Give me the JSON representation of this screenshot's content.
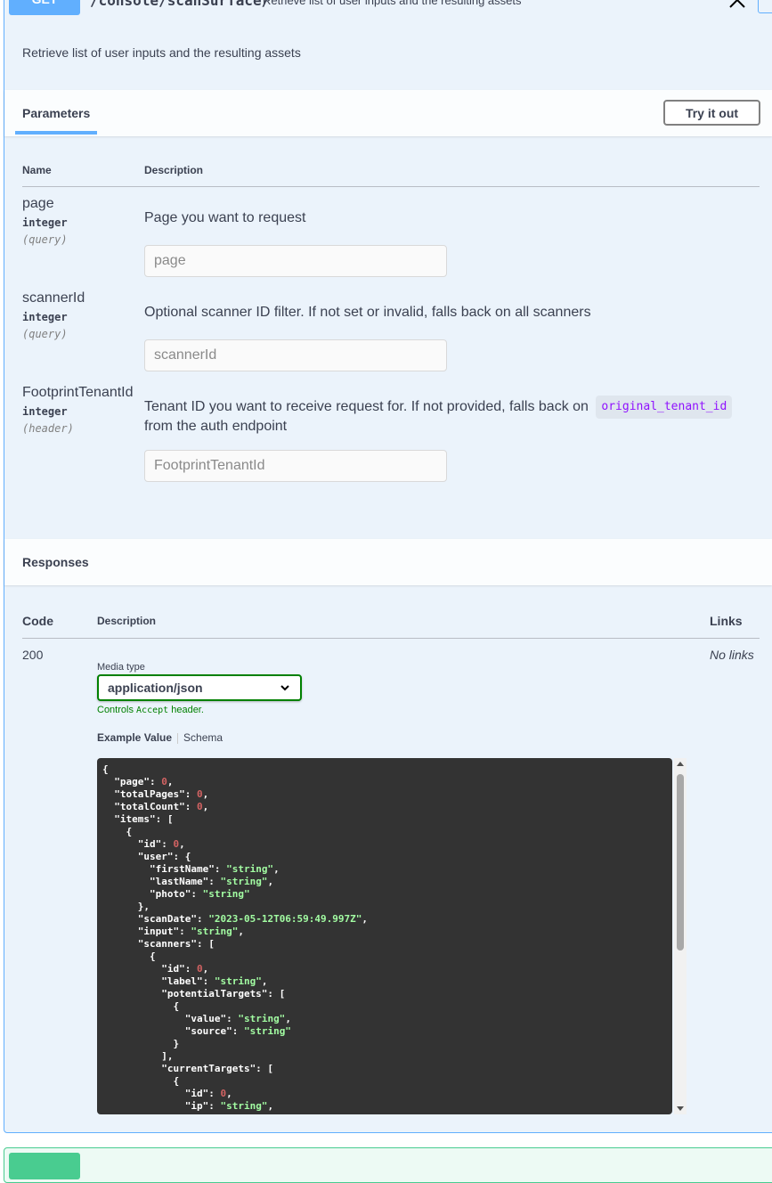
{
  "operation": {
    "method": "GET",
    "path": "/console/scanSurface/",
    "summary": "Retrieve list of user inputs and the resulting assets",
    "description": "Retrieve list of user inputs and the resulting assets"
  },
  "parameters": {
    "tab_label": "Parameters",
    "try_button": "Try it out",
    "col_name": "Name",
    "col_description": "Description",
    "items": [
      {
        "name": "page",
        "type": "integer",
        "in": "(query)",
        "description": "Page you want to request",
        "placeholder": "page"
      },
      {
        "name": "scannerId",
        "type": "integer",
        "in": "(query)",
        "description": "Optional scanner ID filter. If not set or invalid, falls back on all scanners",
        "placeholder": "scannerId"
      },
      {
        "name": "FootprintTenantId",
        "type": "integer",
        "in": "(header)",
        "description_before": "Tenant ID you want to receive request for. If not provided, falls back on",
        "description_code": "original_tenant_id",
        "description_after": "from the auth endpoint",
        "placeholder": "FootprintTenantId"
      }
    ]
  },
  "responses": {
    "title": "Responses",
    "col_code": "Code",
    "col_description": "Description",
    "col_links": "Links",
    "rows": [
      {
        "code": "200",
        "media_type_label": "Media type",
        "media_type_value": "application/json",
        "controls_prefix": "Controls",
        "controls_code": "Accept",
        "controls_suffix": "header.",
        "tab_example": "Example Value",
        "tab_schema": "Schema",
        "links": "No links"
      }
    ],
    "example_lines": [
      [
        [
          "k",
          "{"
        ]
      ],
      [
        [
          "k",
          "  \"page\": "
        ],
        [
          "n",
          "0"
        ],
        [
          "k",
          ","
        ]
      ],
      [
        [
          "k",
          "  \"totalPages\": "
        ],
        [
          "n",
          "0"
        ],
        [
          "k",
          ","
        ]
      ],
      [
        [
          "k",
          "  \"totalCount\": "
        ],
        [
          "n",
          "0"
        ],
        [
          "k",
          ","
        ]
      ],
      [
        [
          "k",
          "  \"items\": ["
        ]
      ],
      [
        [
          "k",
          "    {"
        ]
      ],
      [
        [
          "k",
          "      \"id\": "
        ],
        [
          "n",
          "0"
        ],
        [
          "k",
          ","
        ]
      ],
      [
        [
          "k",
          "      \"user\": {"
        ]
      ],
      [
        [
          "k",
          "        \"firstName\": "
        ],
        [
          "s",
          "\"string\""
        ],
        [
          "k",
          ","
        ]
      ],
      [
        [
          "k",
          "        \"lastName\": "
        ],
        [
          "s",
          "\"string\""
        ],
        [
          "k",
          ","
        ]
      ],
      [
        [
          "k",
          "        \"photo\": "
        ],
        [
          "s",
          "\"string\""
        ]
      ],
      [
        [
          "k",
          "      },"
        ]
      ],
      [
        [
          "k",
          "      \"scanDate\": "
        ],
        [
          "s",
          "\"2023-05-12T06:59:49.997Z\""
        ],
        [
          "k",
          ","
        ]
      ],
      [
        [
          "k",
          "      \"input\": "
        ],
        [
          "s",
          "\"string\""
        ],
        [
          "k",
          ","
        ]
      ],
      [
        [
          "k",
          "      \"scanners\": ["
        ]
      ],
      [
        [
          "k",
          "        {"
        ]
      ],
      [
        [
          "k",
          "          \"id\": "
        ],
        [
          "n",
          "0"
        ],
        [
          "k",
          ","
        ]
      ],
      [
        [
          "k",
          "          \"label\": "
        ],
        [
          "s",
          "\"string\""
        ],
        [
          "k",
          ","
        ]
      ],
      [
        [
          "k",
          "          \"potentialTargets\": ["
        ]
      ],
      [
        [
          "k",
          "            {"
        ]
      ],
      [
        [
          "k",
          "              \"value\": "
        ],
        [
          "s",
          "\"string\""
        ],
        [
          "k",
          ","
        ]
      ],
      [
        [
          "k",
          "              \"source\": "
        ],
        [
          "s",
          "\"string\""
        ]
      ],
      [
        [
          "k",
          "            }"
        ]
      ],
      [
        [
          "k",
          "          ],"
        ]
      ],
      [
        [
          "k",
          "          \"currentTargets\": ["
        ]
      ],
      [
        [
          "k",
          "            {"
        ]
      ],
      [
        [
          "k",
          "              \"id\": "
        ],
        [
          "n",
          "0"
        ],
        [
          "k",
          ","
        ]
      ],
      [
        [
          "k",
          "              \"ip\": "
        ],
        [
          "s",
          "\"string\""
        ],
        [
          "k",
          ","
        ]
      ]
    ]
  },
  "icons": {
    "close": "close-icon",
    "chevron": "chevron-down-icon",
    "scroll_up": "scroll-up-icon",
    "scroll_down": "scroll-down-icon"
  },
  "colors": {
    "get_accent": "#61affe",
    "post_accent": "#49cc90",
    "valid_green": "#008000",
    "code_bg": "#333333",
    "code_string": "#a2fca2",
    "code_number": "#d36363",
    "inline_code": "#9012fe"
  }
}
